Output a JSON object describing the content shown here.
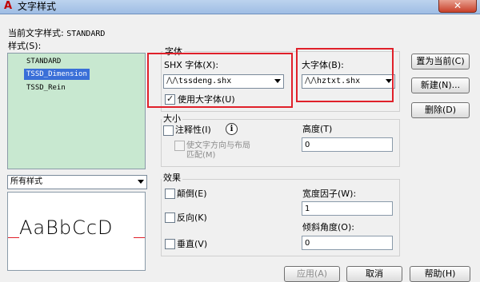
{
  "window": {
    "title": "文字样式",
    "close_glyph": "✕"
  },
  "current_style": {
    "label": "当前文字样式:",
    "value": "STANDARD"
  },
  "styles_label": "样式(S):",
  "styles": [
    "STANDARD",
    "TSSD_Dimension",
    "TSSD_Rein"
  ],
  "selected_style_index": 1,
  "filter_select": {
    "value": "所有样式"
  },
  "preview_text": "AaBbCcD",
  "font_group": {
    "title": "字体",
    "shx_label": "SHX 字体(X):",
    "shx_value": "tssdeng.shx",
    "bigfont_label": "大字体(B):",
    "bigfont_value": "hztxt.shx",
    "use_bigfont_label": "使用大字体(U)",
    "use_bigfont_checked": true
  },
  "size_group": {
    "title": "大小",
    "annotative_label": "注释性(I)",
    "annotative_checked": false,
    "match_orientation_label_1": "使文字方向与布局",
    "match_orientation_label_2": "匹配(M)",
    "height_label": "高度(T)",
    "height_value": "0"
  },
  "effects_group": {
    "title": "效果",
    "upside_down_label": "颠倒(E)",
    "backwards_label": "反向(K)",
    "vertical_label": "垂直(V)",
    "width_factor_label": "宽度因子(W):",
    "width_factor_value": "1",
    "oblique_label": "倾斜角度(O):",
    "oblique_value": "0"
  },
  "buttons": {
    "set_current": "置为当前(C)",
    "new": "新建(N)...",
    "delete": "删除(D)",
    "apply": "应用(A)",
    "cancel": "取消",
    "help": "帮助(H)"
  },
  "colors": {
    "highlight": "#e0202a",
    "selection": "#3a6fd8",
    "list_bg": "#c8e8d0"
  }
}
